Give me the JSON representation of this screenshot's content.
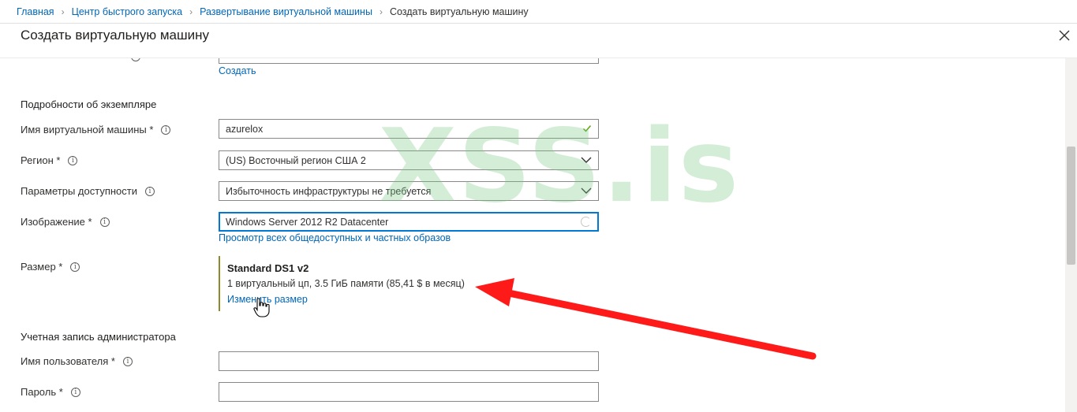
{
  "breadcrumb": {
    "items": [
      "Главная",
      "Центр быстрого запуска",
      "Развертывание виртуальной машины"
    ],
    "current": "Создать виртуальную машину"
  },
  "blade": {
    "title": "Создать виртуальную машину"
  },
  "form": {
    "create_link": "Создать",
    "instance_section": "Подробности об экземпляре",
    "vm_name": {
      "label": "Имя виртуальной машины *",
      "value": "azurelox"
    },
    "region": {
      "label": "Регион *",
      "value": "(US) Восточный регион США 2"
    },
    "availability": {
      "label": "Параметры доступности",
      "value": "Избыточность инфраструктуры не требуется"
    },
    "image": {
      "label": "Изображение *",
      "value": "Windows Server 2012 R2 Datacenter",
      "browse_link": "Просмотр всех общедоступных и частных образов"
    },
    "size": {
      "label": "Размер *",
      "name": "Standard DS1 v2",
      "description": "1 виртуальный цп, 3.5 ГиБ памяти (85,41 $ в месяц)",
      "change_link": "Изменить размер"
    },
    "admin_section": "Учетная запись администратора",
    "username": {
      "label": "Имя пользователя *",
      "value": ""
    },
    "password": {
      "label": "Пароль *",
      "value": ""
    }
  },
  "watermark": "XSS.is",
  "colors": {
    "link": "#0066b8",
    "focus": "#0078d4",
    "arrow": "#ff1a1a",
    "check": "#57a300"
  }
}
